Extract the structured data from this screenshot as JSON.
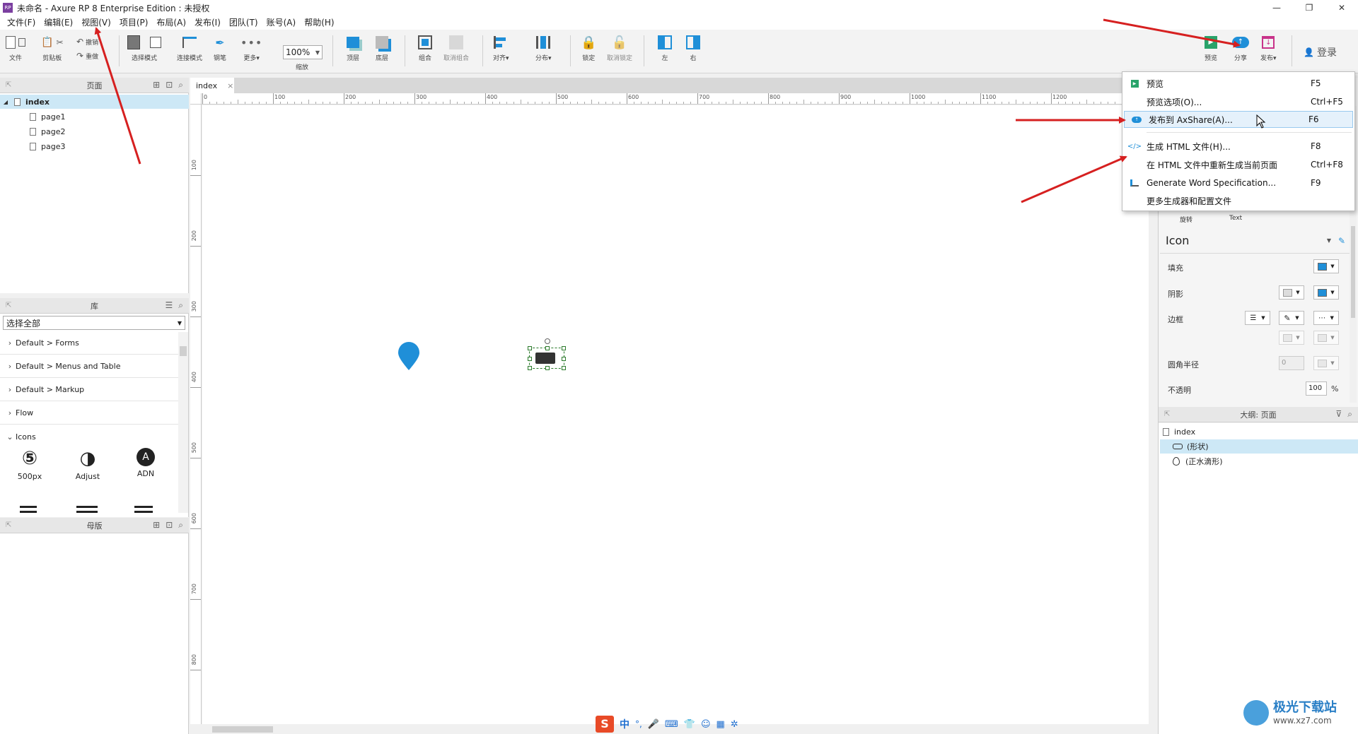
{
  "window": {
    "title": "未命名 - Axure RP 8 Enterprise Edition : 未授权",
    "logo_text": "RP",
    "minimize": "—",
    "maximize": "❐",
    "close": "✕"
  },
  "menubar": [
    "文件(F)",
    "编辑(E)",
    "视图(V)",
    "项目(P)",
    "布局(A)",
    "发布(I)",
    "团队(T)",
    "账号(A)",
    "帮助(H)"
  ],
  "toolbar": {
    "file": "文件",
    "clipboard": "剪贴板",
    "undo": "撤销",
    "redo": "重做",
    "select_mode": "选择模式",
    "connect_mode": "连接模式",
    "pen": "钢笔",
    "more": "更多▾",
    "zoom_value": "100%",
    "zoom_label": "缩放",
    "top": "顶层",
    "bottom": "底层",
    "group": "组合",
    "ungroup": "取消组合",
    "align": "对齐▾",
    "distribute": "分布▾",
    "lock": "锁定",
    "unlock": "取消锁定",
    "left": "左",
    "right": "右",
    "preview": "预览",
    "share": "分享",
    "publish": "发布▾",
    "login": "登录"
  },
  "pages_panel": {
    "title": "页面",
    "root": "index",
    "children": [
      "page1",
      "page2",
      "page3"
    ]
  },
  "library_panel": {
    "title": "库",
    "selector": "选择全部",
    "groups": [
      "Default > Forms",
      "Default > Menus and Table",
      "Default > Markup",
      "Flow",
      "Icons"
    ],
    "icons": [
      "500px",
      "Adjust",
      "ADN"
    ]
  },
  "masters_panel": {
    "title": "母版"
  },
  "canvas": {
    "tab": "index",
    "tab_close": "×",
    "ruler_h": [
      "0",
      "100",
      "200",
      "300",
      "400",
      "500",
      "600",
      "700",
      "800",
      "900",
      "1000",
      "1100",
      "1200"
    ],
    "ruler_v": [
      "100",
      "200",
      "300",
      "400",
      "500",
      "600",
      "700",
      "800"
    ]
  },
  "inspector": {
    "rotate_label": "旋转",
    "text_label": "Text",
    "style_name": "Icon",
    "fill": "填充",
    "shadow": "阴影",
    "border": "边框",
    "radius": "圆角半径",
    "radius_value": "0",
    "opacity": "不透明",
    "opacity_value": "100",
    "opacity_unit": "%"
  },
  "outline_panel": {
    "title": "大纲: 页面",
    "root": "index",
    "items": [
      "(形状)",
      "(正水滴形)"
    ]
  },
  "publish_menu": {
    "items": [
      {
        "label": "预览",
        "key": "F5"
      },
      {
        "label": "预览选项(O)...",
        "key": "Ctrl+F5"
      },
      {
        "label": "发布到 AxShare(A)...",
        "key": "F6"
      },
      {
        "label": "生成 HTML 文件(H)...",
        "key": "F8"
      },
      {
        "label": "在 HTML 文件中重新生成当前页面",
        "key": "Ctrl+F8"
      },
      {
        "label": "Generate Word Specification...",
        "key": "F9"
      },
      {
        "label": "更多生成器和配置文件",
        "key": ""
      }
    ]
  },
  "ime_bar": {
    "logo": "S",
    "lang": "中",
    "punct": "°,"
  },
  "watermark": {
    "name": "极光下载站",
    "url": "www.xz7.com"
  },
  "colors": {
    "accent": "#1f8fd8",
    "selected": "#cde8f6",
    "arrow": "#d62020",
    "logo": "#7b3fa0"
  }
}
